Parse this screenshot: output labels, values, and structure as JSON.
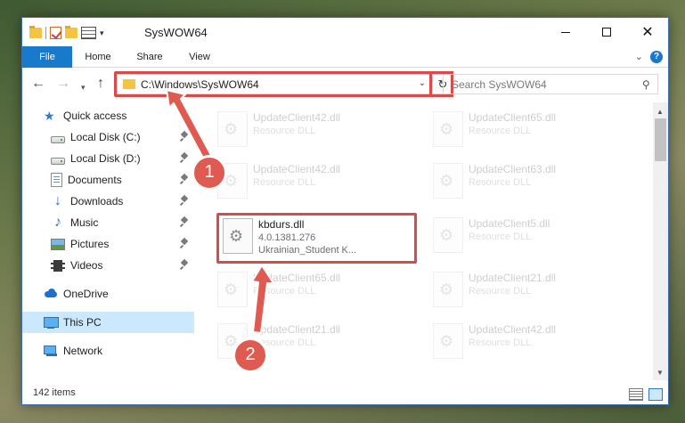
{
  "window": {
    "title": "SysWOW64",
    "minimize_glyph": "—",
    "maximize_glyph": "☐",
    "close_glyph": "✕"
  },
  "ribbon": {
    "tabs": [
      "File",
      "Home",
      "Share",
      "View"
    ],
    "help_label": "?"
  },
  "navbar": {
    "address_path": "C:\\Windows\\SysWOW64",
    "search_placeholder": "Search SysWOW64"
  },
  "sidebar": {
    "items": [
      {
        "label": "Quick access",
        "icon": "star-icon"
      },
      {
        "label": "Local Disk (C:)",
        "icon": "drive-icon",
        "pinned": true
      },
      {
        "label": "Local Disk (D:)",
        "icon": "drive-icon",
        "pinned": true
      },
      {
        "label": "Documents",
        "icon": "documents-icon",
        "pinned": true
      },
      {
        "label": "Downloads",
        "icon": "downloads-icon",
        "pinned": true
      },
      {
        "label": "Music",
        "icon": "music-icon",
        "pinned": true
      },
      {
        "label": "Pictures",
        "icon": "pictures-icon",
        "pinned": true
      },
      {
        "label": "Videos",
        "icon": "videos-icon",
        "pinned": true
      },
      {
        "label": "OneDrive",
        "icon": "cloud-icon"
      },
      {
        "label": "This PC",
        "icon": "computer-icon",
        "selected": true
      },
      {
        "label": "Network",
        "icon": "network-icon"
      }
    ]
  },
  "files": {
    "left_column": [
      {
        "name": "UpdateClient42.dll",
        "type": "Resource DLL"
      },
      {
        "name": "UpdateClient42.dll",
        "type": "Resource DLL"
      },
      {
        "name": "kbdurs.dll",
        "version": "4.0.1381.276",
        "description": "Ukrainian_Student K..."
      },
      {
        "name": "UpdateClient65.dll",
        "type": "Resource DLL"
      },
      {
        "name": "UpdateClient21.dll",
        "type": "Resource DLL"
      }
    ],
    "right_column": [
      {
        "name": "UpdateClient65.dll",
        "type": "Resource DLL"
      },
      {
        "name": "UpdateClient63.dll",
        "type": "Resource DLL"
      },
      {
        "name": "UpdateClient5.dll",
        "type": "Resource DLL"
      },
      {
        "name": "UpdateClient21.dll",
        "type": "Resource DLL"
      },
      {
        "name": "UpdateClient42.dll",
        "type": "Resource DLL"
      }
    ]
  },
  "status": {
    "item_count": "142 items"
  },
  "callouts": [
    {
      "number": "1"
    },
    {
      "number": "2"
    }
  ],
  "colors": {
    "accent": "#1979ca",
    "highlight_red": "#d94a4a",
    "selected_bg": "#cce8ff"
  }
}
